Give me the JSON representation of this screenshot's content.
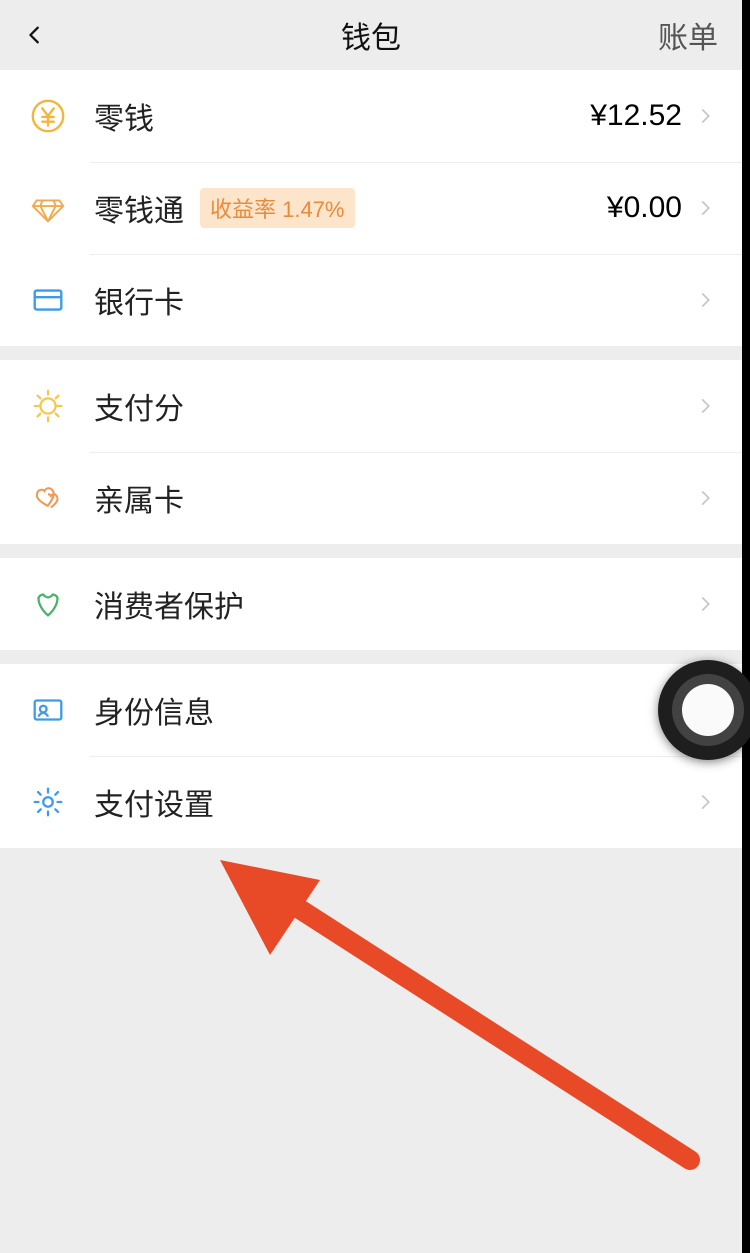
{
  "header": {
    "title": "钱包",
    "right_label": "账单"
  },
  "groups": [
    {
      "id": "g1",
      "rows": [
        {
          "id": "balance",
          "label": "零钱",
          "value": "¥12.52"
        },
        {
          "id": "lqt",
          "label": "零钱通",
          "badge": "收益率 1.47%",
          "value": "¥0.00"
        },
        {
          "id": "cards",
          "label": "银行卡"
        }
      ]
    },
    {
      "id": "g2",
      "rows": [
        {
          "id": "score",
          "label": "支付分"
        },
        {
          "id": "family",
          "label": "亲属卡"
        }
      ]
    },
    {
      "id": "g3",
      "rows": [
        {
          "id": "protect",
          "label": "消费者保护"
        }
      ]
    },
    {
      "id": "g4",
      "rows": [
        {
          "id": "identity",
          "label": "身份信息"
        },
        {
          "id": "settings",
          "label": "支付设置"
        }
      ]
    }
  ]
}
